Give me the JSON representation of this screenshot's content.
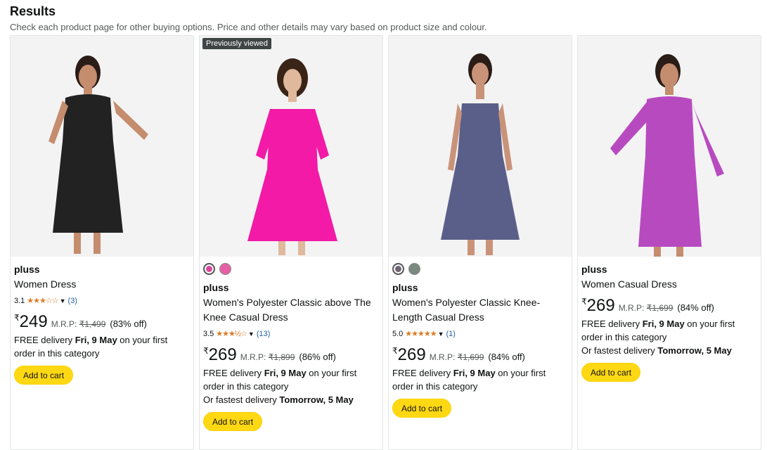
{
  "header": {
    "title": "Results",
    "subtitle": "Check each product page for other buying options. Price and other details may vary based on product size and colour."
  },
  "products": [
    {
      "badge": "",
      "swatches": [],
      "brand": "pluss",
      "title": "Women Dress",
      "rating_value": "3.1",
      "stars": "★★★☆☆",
      "rating_count": "(3)",
      "currency": "₹",
      "price": "249",
      "mrp_label": "M.R.P:",
      "mrp": "₹1,499",
      "discount": "(83% off)",
      "delivery_prefix": "FREE delivery ",
      "delivery_date": "Fri, 9 May",
      "delivery_suffix": " on your first order in this category",
      "fast_prefix": "",
      "fast_date": "",
      "button": "Add to cart",
      "dress_color": "#222222"
    },
    {
      "badge": "Previously viewed",
      "swatches": [
        "#d9479a",
        "#e65fa3"
      ],
      "brand": "pluss",
      "title": "Women's Polyester Classic above The Knee Casual Dress",
      "rating_value": "3.5",
      "stars": "★★★½☆",
      "rating_count": "(13)",
      "currency": "₹",
      "price": "269",
      "mrp_label": "M.R.P:",
      "mrp": "₹1,899",
      "discount": "(86% off)",
      "delivery_prefix": "FREE delivery ",
      "delivery_date": "Fri, 9 May",
      "delivery_suffix": " on your first order in this category",
      "fast_prefix": "Or fastest delivery ",
      "fast_date": "Tomorrow, 5 May",
      "button": "Add to cart",
      "dress_color": "#f21aa6"
    },
    {
      "badge": "",
      "swatches": [
        "#6e6472",
        "#7a8a80"
      ],
      "brand": "pluss",
      "title": "Women's Polyester Classic Knee-Length Casual Dress",
      "rating_value": "5.0",
      "stars": "★★★★★",
      "rating_count": "(1)",
      "currency": "₹",
      "price": "269",
      "mrp_label": "M.R.P:",
      "mrp": "₹1,699",
      "discount": "(84% off)",
      "delivery_prefix": "FREE delivery ",
      "delivery_date": "Fri, 9 May",
      "delivery_suffix": " on your first order in this category",
      "fast_prefix": "",
      "fast_date": "",
      "button": "Add to cart",
      "dress_color": "#5a5f8a"
    },
    {
      "badge": "",
      "swatches": [],
      "brand": "pluss",
      "title": "Women Casual Dress",
      "rating_value": "",
      "stars": "",
      "rating_count": "",
      "currency": "₹",
      "price": "269",
      "mrp_label": "M.R.P:",
      "mrp": "₹1,699",
      "discount": "(84% off)",
      "delivery_prefix": "FREE delivery ",
      "delivery_date": "Fri, 9 May",
      "delivery_suffix": " on your first order in this category",
      "fast_prefix": "Or fastest delivery ",
      "fast_date": "Tomorrow, 5 May",
      "button": "Add to cart",
      "dress_color": "#b84ac0"
    }
  ]
}
